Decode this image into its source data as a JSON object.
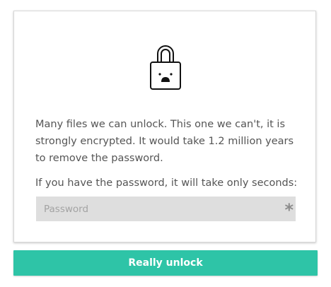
{
  "message": "Many files we can unlock. This one we can't, it is strongly encrypted. It would take 1.2 million years to remove the password.",
  "hint": "If you have the password, it will take only seconds:",
  "password_field": {
    "placeholder": "Password",
    "value": "",
    "icon": "asterisk-icon"
  },
  "unlock_button": {
    "label": "Really unlock"
  },
  "lock_icon": "sad-lock-icon",
  "colors": {
    "accent": "#2ec4a7",
    "text": "#555555",
    "input_background": "#dedede"
  }
}
